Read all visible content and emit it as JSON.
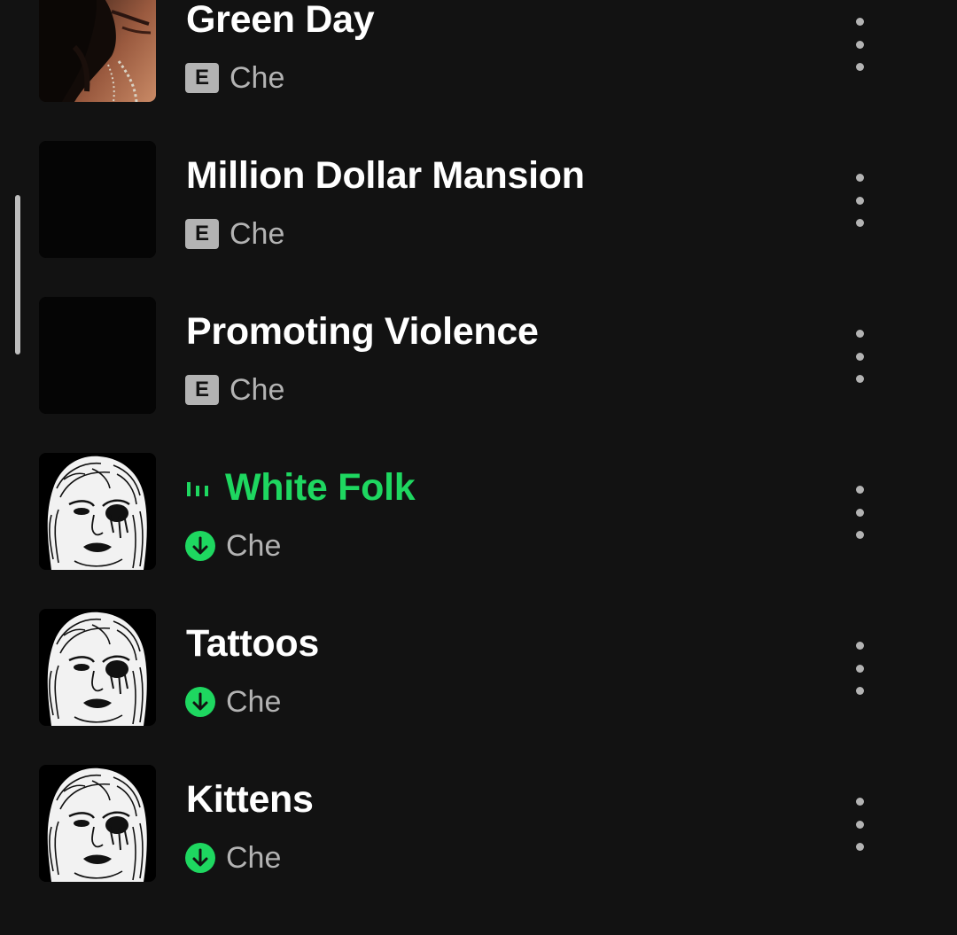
{
  "colors": {
    "background": "#121212",
    "accent_green": "#1ed760",
    "text_primary": "#ffffff",
    "text_secondary": "#b3b3b3"
  },
  "tracks": [
    {
      "title": "Green Day",
      "artist": "Che",
      "explicit": true,
      "explicit_label": "E",
      "downloaded": false,
      "playing": false,
      "artwork": "photo-artwork"
    },
    {
      "title": "Million Dollar Mansion",
      "artist": "Che",
      "explicit": true,
      "explicit_label": "E",
      "downloaded": false,
      "playing": false,
      "artwork": "black-artwork"
    },
    {
      "title": "Promoting Violence",
      "artist": "Che",
      "explicit": true,
      "explicit_label": "E",
      "downloaded": false,
      "playing": false,
      "artwork": "black-artwork"
    },
    {
      "title": "White Folk",
      "artist": "Che",
      "explicit": false,
      "downloaded": true,
      "playing": true,
      "artwork": "sketch-portrait-artwork"
    },
    {
      "title": "Tattoos",
      "artist": "Che",
      "explicit": false,
      "downloaded": true,
      "playing": false,
      "artwork": "sketch-portrait-artwork"
    },
    {
      "title": "Kittens",
      "artist": "Che",
      "explicit": false,
      "downloaded": true,
      "playing": false,
      "artwork": "sketch-portrait-artwork"
    }
  ],
  "icons": {
    "playing": "equalizer-icon",
    "downloaded": "download-icon",
    "more": "more-options-icon"
  }
}
